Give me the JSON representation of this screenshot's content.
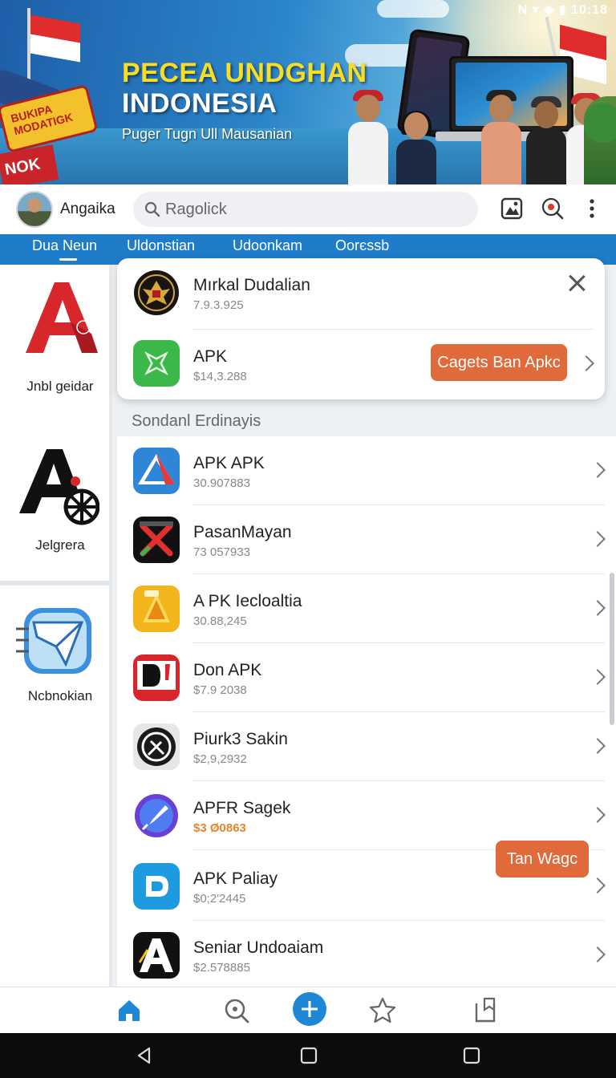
{
  "banner": {
    "title_line1": "PECEA UNDGHAN",
    "title_line2": "INDONESIA",
    "subtitle": "Puger Tugn Ull Mausanian",
    "status_time": "N ▾ ◆ ▮ 10:18",
    "sign_text": "BUKIPA MODATIGK",
    "badge_text": "NOK",
    "colors": {
      "flag_red": "#e02c2c",
      "title_yellow": "#f6dd2a"
    }
  },
  "header": {
    "user_name": "Angaika",
    "search_placeholder": "Ragolick",
    "icons": [
      "image-icon",
      "tag-search-icon",
      "more-vertical-icon"
    ]
  },
  "tabs": [
    {
      "label": "Dua Neun",
      "active": true
    },
    {
      "label": "Uldonstian",
      "active": false
    },
    {
      "label": "Udoonkam",
      "active": false
    },
    {
      "label": "Oorєssb",
      "active": false
    }
  ],
  "sidebar": {
    "items": [
      {
        "label": "Jnbl geidar",
        "icon": "red-a-app-icon"
      },
      {
        "label": "Jelgrera",
        "icon": "a-gear-app-icon"
      },
      {
        "label": "Ncbnokian",
        "icon": "blue-envelope-app-icon"
      }
    ]
  },
  "popup": {
    "items": [
      {
        "title": "Mırkal Dudalian",
        "subtitle": "7.9.3.925",
        "icon": "garuda-emblem-icon"
      },
      {
        "title": "APK",
        "subtitle": "$14,3.288",
        "icon": "green-star-app-icon",
        "action_label": "Cagets Ban Apkc"
      }
    ]
  },
  "section_title": "Sondanl Erdinayis",
  "list": [
    {
      "title": "APK APK",
      "subtitle": "30.907883",
      "icon": "blue-triangle-app-icon"
    },
    {
      "title": "PasanMayan",
      "subtitle": "73 057933",
      "icon": "red-x-app-icon"
    },
    {
      "title": "A PK Iecloaltia",
      "subtitle": "30.88,245",
      "icon": "orange-on-app-icon"
    },
    {
      "title": "Don APK",
      "subtitle": "$7.9 2038",
      "icon": "red-d-app-icon"
    },
    {
      "title": "Piurk3 Sakin",
      "subtitle": "$2,9,2932",
      "icon": "black-compass-app-icon"
    },
    {
      "title": "APFR Sagek",
      "subtitle": "$3 Ø0863",
      "icon": "purple-rocket-app-icon",
      "subtitle_color": "#e8862a"
    },
    {
      "title": "APK Paliay",
      "subtitle": "$0;2'2445",
      "icon": "blue-d-app-icon"
    },
    {
      "title": "Seniar Undoaiam",
      "subtitle": "$2.578885",
      "icon": "black-a-app-icon"
    }
  ],
  "floating_button": "Tan Wagc",
  "bottom_nav": [
    "home-icon",
    "search-icon",
    "add-icon",
    "star-icon",
    "bookmark-icon"
  ],
  "system_nav": [
    "back-icon",
    "home-square-icon",
    "recents-icon"
  ],
  "colors": {
    "tab_blue": "#1f7cc8",
    "orange": "#e06a3a",
    "accent_blue": "#1e88d6"
  }
}
